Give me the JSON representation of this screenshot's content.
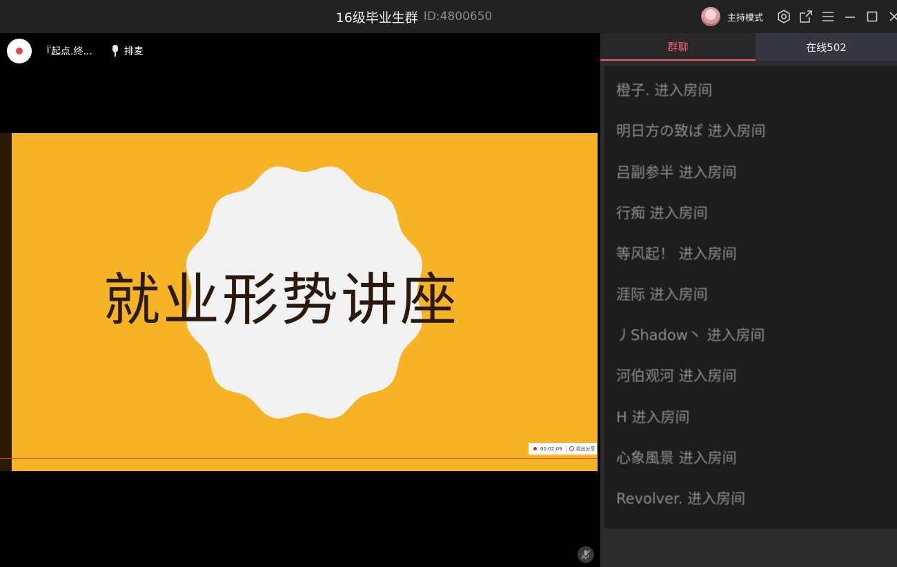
{
  "window": {
    "title": "16级毕业生群",
    "id_label": "ID:4800650",
    "host_mode_label": "主持模式"
  },
  "stage": {
    "host_name": "『起点.终...",
    "queue_label": "排麦",
    "slide": {
      "title": "就业形势讲座",
      "record_time": "00:02:09",
      "exit_share_label": "退出分享"
    }
  },
  "panel": {
    "tabs": [
      {
        "label": "群聊",
        "active": true
      },
      {
        "label": "在线502",
        "active": false
      }
    ],
    "messages": [
      {
        "text": "橙子. 进入房间"
      },
      {
        "text": "明日方の致ぱ 进入房间"
      },
      {
        "text": "吕副参半 进入房间"
      },
      {
        "text": "行痴 进入房间"
      },
      {
        "text": "等风起！ 进入房间"
      },
      {
        "text": "涯际 进入房间"
      },
      {
        "text": "丿Shadow丶 进入房间"
      },
      {
        "text": "河伯观河 进入房间"
      },
      {
        "text": "H 进入房间"
      },
      {
        "text": "心象風景 进入房间"
      },
      {
        "text": "Revolver. 进入房间"
      }
    ]
  },
  "icons": {
    "settings": "gear-icon",
    "popout": "external-window-icon",
    "menu": "hamburger-menu-icon",
    "minimize": "minimize-icon",
    "maximize": "maximize-icon",
    "close": "close-icon",
    "mic": "microphone-icon",
    "mic_muted": "microphone-muted-icon"
  },
  "colors": {
    "titlebar": "#222222",
    "accent": "#f25a71",
    "slide_bg": "#f5b325",
    "slide_text": "#2a1a0c",
    "badge": "#f2f2f2"
  }
}
